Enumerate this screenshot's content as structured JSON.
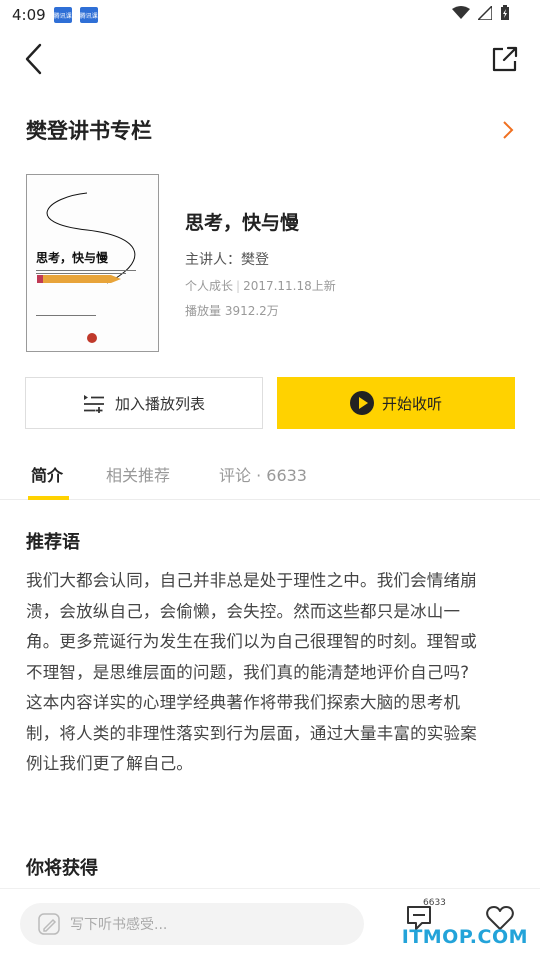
{
  "status_bar": {
    "time": "4:09",
    "app_badge": "腾讯课"
  },
  "column": {
    "title": "樊登讲书专栏"
  },
  "book": {
    "cover_title": "思考，快与慢",
    "title": "思考，快与慢",
    "speaker": "主讲人：樊登",
    "category": "个人成长",
    "date": "2017.11.18上新",
    "plays": "播放量 3912.2万"
  },
  "actions": {
    "playlist_label": "加入播放列表",
    "listen_label": "开始收听"
  },
  "tabs": [
    {
      "label": "简介",
      "active": true
    },
    {
      "label": "相关推荐",
      "active": false
    },
    {
      "label": "评论 · 6633",
      "active": false
    }
  ],
  "intro": {
    "heading": "推荐语",
    "lines": [
      "我们大都会认同，自己并非总是处于理性之中。我们会情绪崩",
      "溃，会放纵自己，会偷懒，会失控。然而这些都只是冰山一",
      "角。更多荒诞行为发生在我们以为自己很理智的时刻。理智或",
      "不理智，是思维层面的问题，我们真的能清楚地评价自己吗?",
      "这本内容详实的心理学经典著作将带我们探索大脑的思考机",
      "制，将人类的非理性落实到行为层面，通过大量丰富的实验案",
      "例让我们更了解自己。"
    ]
  },
  "gain": {
    "heading": "你将获得"
  },
  "bottom": {
    "placeholder": "写下听书感受...",
    "comment_count": "6633"
  },
  "watermark": "ITMOP.COM",
  "colors": {
    "accent": "#ffd200",
    "chevron": "#f07020",
    "watermark": "#23a3d9"
  }
}
